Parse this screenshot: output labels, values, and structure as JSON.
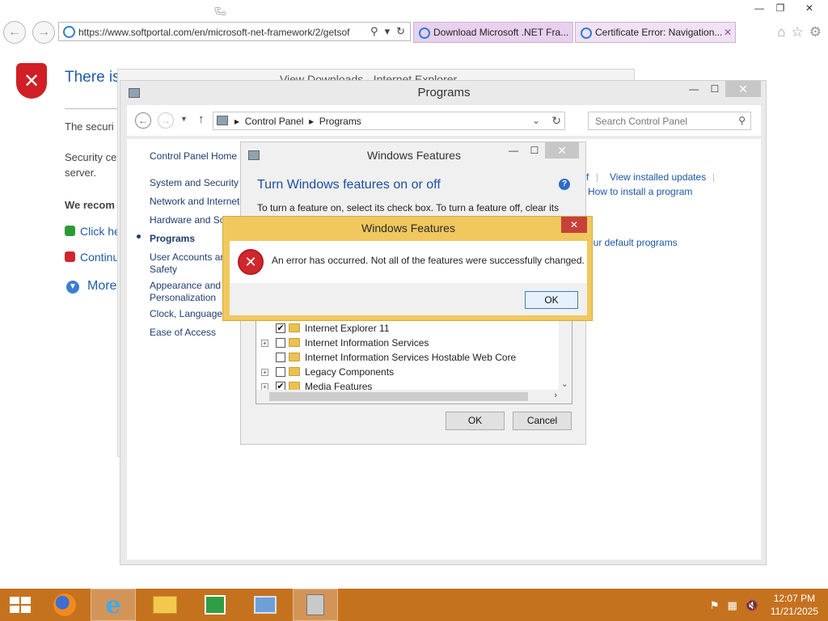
{
  "ie": {
    "url": "https://www.softportal.com/en/microsoft-net-framework/2/getsof",
    "tabs": [
      {
        "label": "Download Microsoft .NET Fra..."
      },
      {
        "label": "Certificate Error: Navigation..."
      }
    ],
    "page": {
      "heading": "There is",
      "text1": "The securi",
      "text2a": "Security ce",
      "text2b": "server.",
      "recommend": "We recom",
      "link1": "Click he",
      "link2": "Continu",
      "more": "More"
    }
  },
  "view_downloads": {
    "title": "View Downloads - Internet Explorer"
  },
  "programs": {
    "title": "Programs",
    "breadcrumb": [
      "Control Panel",
      "Programs"
    ],
    "search_placeholder": "Search Control Panel",
    "sidebar": [
      "Control Panel Home",
      "System and Security",
      "Network and Internet",
      "Hardware and So",
      "Programs",
      "User Accounts an",
      "Safety",
      "Appearance and",
      "Personalization",
      "Clock, Language,",
      "Ease of Access"
    ],
    "links": {
      "fragment_f": "f",
      "view_updates": "View installed updates",
      "install_how": "How to install a program",
      "default_programs": "our default programs"
    }
  },
  "windows_features": {
    "title": "Windows Features",
    "heading": "Turn Windows features on or off",
    "description": "To turn a feature on, select its check box. To turn a feature off, clear its",
    "tree": [
      {
        "label": "Internet Explorer 11",
        "checked": "✔",
        "expand": ""
      },
      {
        "label": "Internet Information Services",
        "checked": "",
        "expand": "+"
      },
      {
        "label": "Internet Information Services Hostable Web Core",
        "checked": "",
        "expand": ""
      },
      {
        "label": "Legacy Components",
        "checked": "",
        "expand": "+"
      },
      {
        "label": "Media Features",
        "checked": "✔",
        "expand": "+"
      }
    ],
    "ok": "OK",
    "cancel": "Cancel"
  },
  "error_dialog": {
    "title": "Windows Features",
    "message": "An error has occurred. Not all of the features were successfully changed.",
    "ok": "OK"
  },
  "taskbar": {
    "time": "12:07 PM",
    "date": "11/21/2025"
  },
  "colors": {
    "taskbar": "#c5721f",
    "error_frame": "#f0c85e",
    "link": "#1a56a8",
    "tab": "#e8d0ee"
  }
}
